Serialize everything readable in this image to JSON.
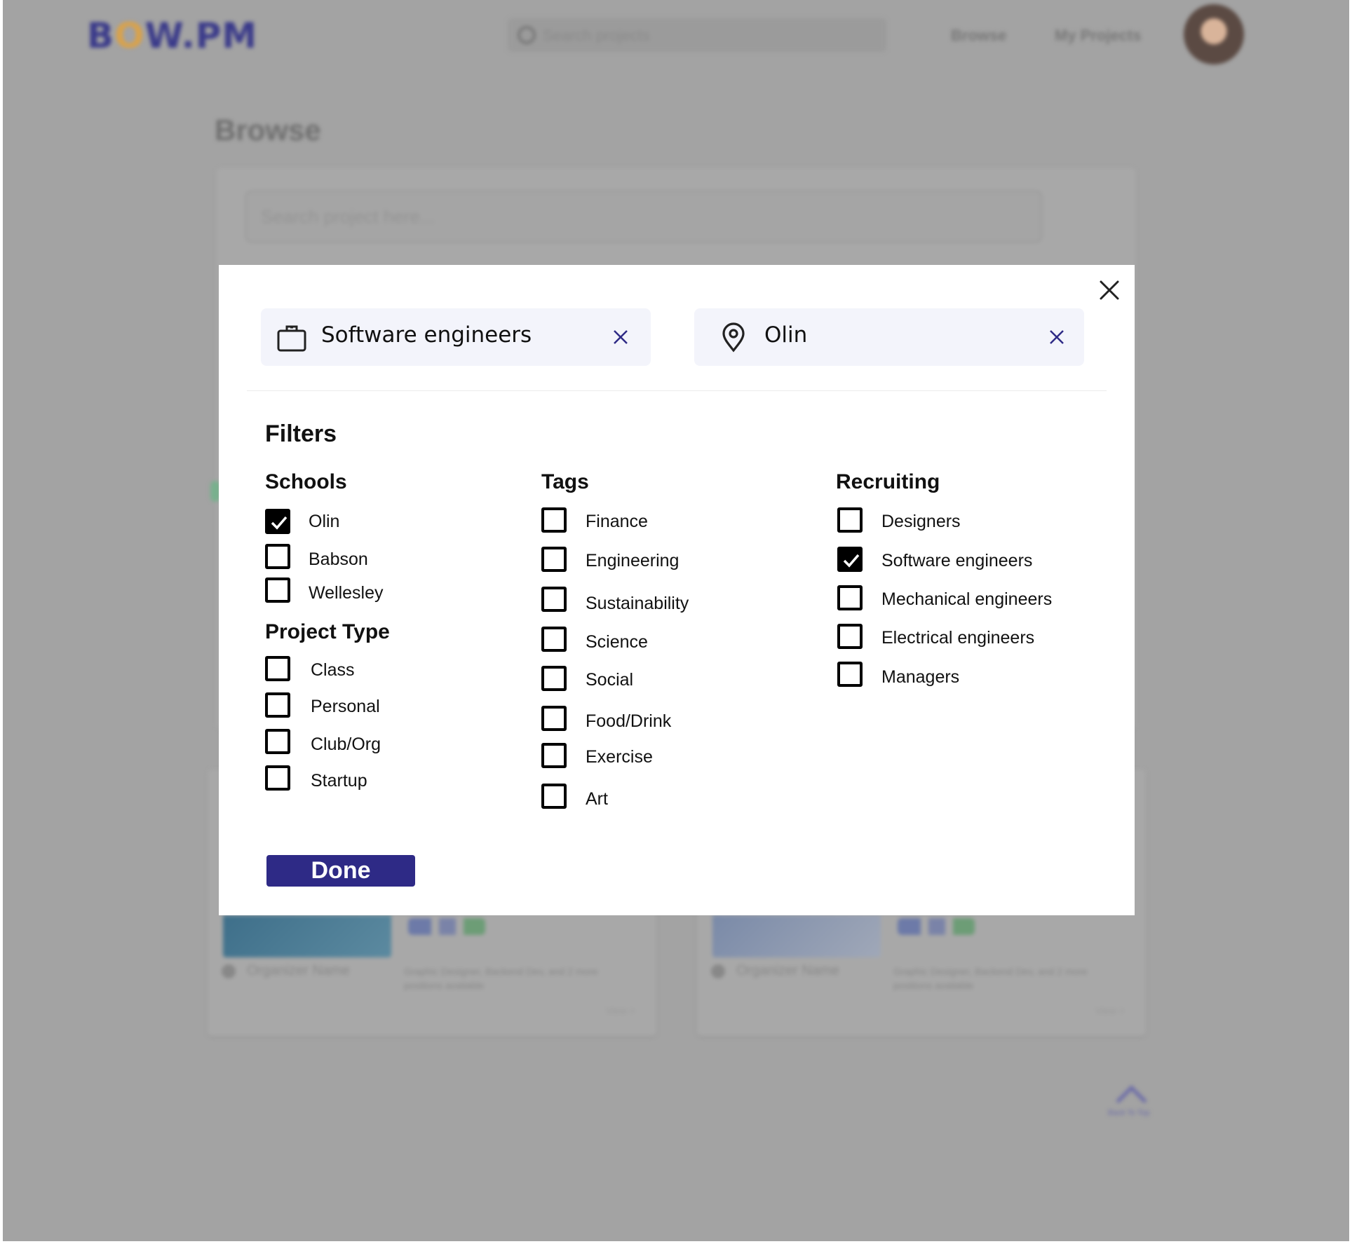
{
  "background": {
    "logo": "BOW.PM",
    "logo_parts": [
      "B",
      "O",
      "W.PM"
    ],
    "search_placeholder": "Search projects",
    "nav": {
      "browse": "Browse",
      "my_projects": "My Projects"
    },
    "page_title": "Browse",
    "panel_search_placeholder": "Search project here...",
    "cards": [
      {
        "organizer": "Organizer Name",
        "positions": "Graphic Designer, Backend Dev, and 2 more positions available",
        "view": "View >"
      },
      {
        "organizer": "Organizer Name",
        "positions": "Graphic Designer, Backend Dev, and 2 more positions available",
        "view": "View >"
      }
    ],
    "back_to_top": "Back To Top"
  },
  "modal": {
    "role_chip": {
      "icon": "briefcase-icon",
      "text": "Software engineers"
    },
    "location_chip": {
      "icon": "location-pin-icon",
      "text": "Olin"
    },
    "filters_heading": "Filters",
    "schools": {
      "heading": "Schools",
      "options": [
        {
          "label": "Olin",
          "checked": true
        },
        {
          "label": "Babson",
          "checked": false
        },
        {
          "label": "Wellesley",
          "checked": false
        }
      ]
    },
    "project_type": {
      "heading": "Project Type",
      "options": [
        {
          "label": "Class",
          "checked": false
        },
        {
          "label": "Personal",
          "checked": false
        },
        {
          "label": "Club/Org",
          "checked": false
        },
        {
          "label": "Startup",
          "checked": false
        }
      ]
    },
    "tags": {
      "heading": "Tags",
      "options": [
        {
          "label": "Finance",
          "checked": false
        },
        {
          "label": "Engineering",
          "checked": false
        },
        {
          "label": "Sustainability",
          "checked": false
        },
        {
          "label": "Science",
          "checked": false
        },
        {
          "label": "Social",
          "checked": false
        },
        {
          "label": "Food/Drink",
          "checked": false
        },
        {
          "label": "Exercise",
          "checked": false
        },
        {
          "label": "Art",
          "checked": false
        }
      ]
    },
    "recruiting": {
      "heading": "Recruiting",
      "options": [
        {
          "label": "Designers",
          "checked": false
        },
        {
          "label": "Software engineers",
          "checked": true
        },
        {
          "label": "Mechanical engineers",
          "checked": false
        },
        {
          "label": "Electrical engineers",
          "checked": false
        },
        {
          "label": "Managers",
          "checked": false
        }
      ]
    },
    "done_label": "Done"
  },
  "colors": {
    "overlay": "#a3a3a3",
    "chip_bg": "#f3f4fb",
    "accent": "#2e2a86",
    "clear_icon": "#2e2a86"
  }
}
